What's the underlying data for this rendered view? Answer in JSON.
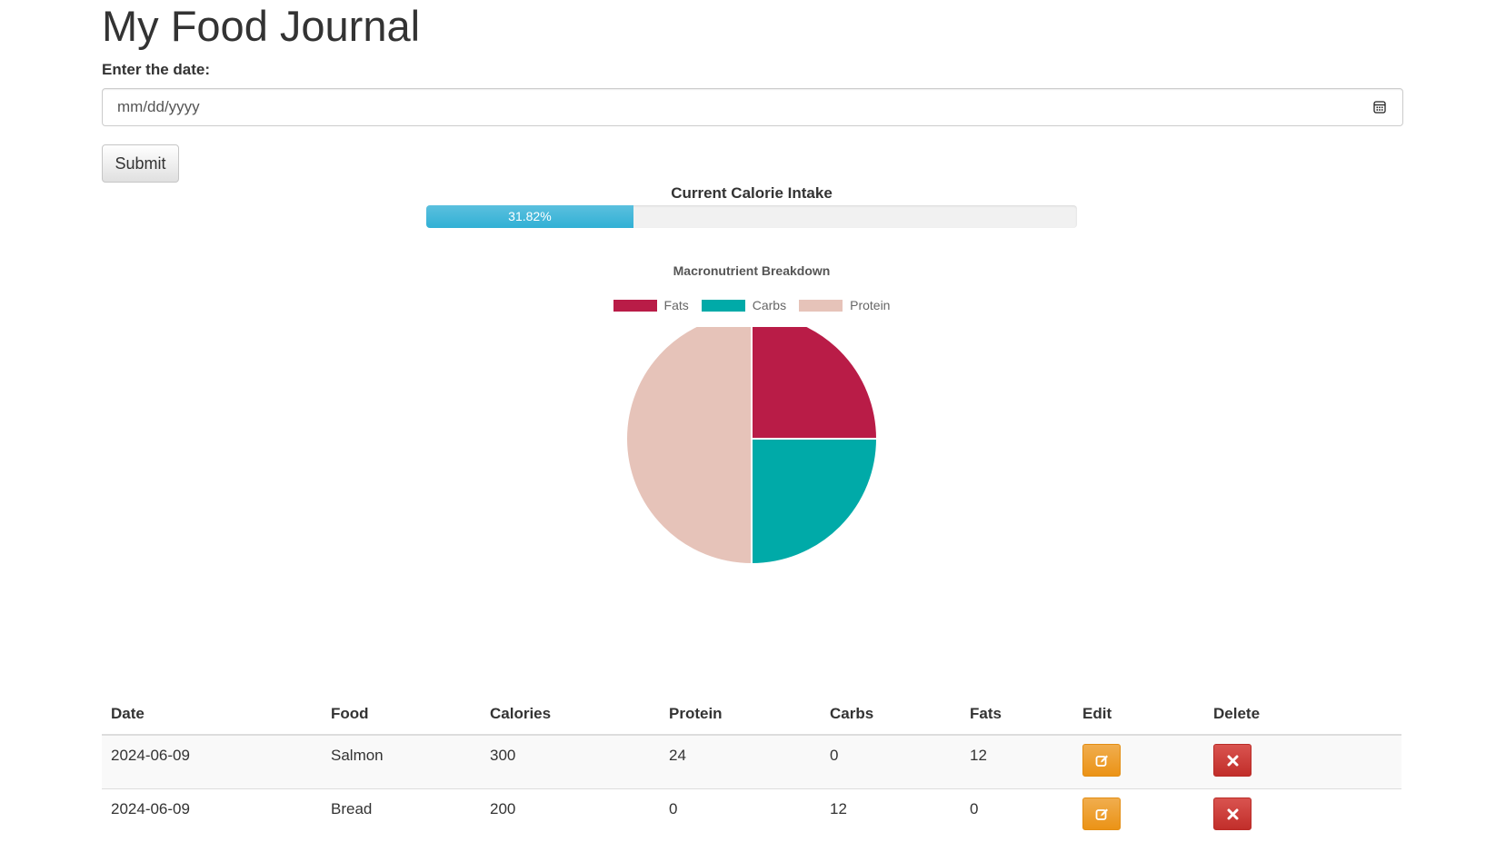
{
  "page": {
    "title": "My Food Journal"
  },
  "date_form": {
    "label": "Enter the date:",
    "placeholder": "mm/dd/yyyy",
    "value": "",
    "calendar_icon": "calendar-icon",
    "submit_label": "Submit"
  },
  "calorie_progress": {
    "title": "Current Calorie Intake",
    "percent": 31.82,
    "label": "31.82%",
    "color": "#5bc0de"
  },
  "chart_data": {
    "type": "pie",
    "title": "Macronutrient Breakdown",
    "categories": [
      "Fats",
      "Carbs",
      "Protein"
    ],
    "values": [
      12,
      12,
      24
    ],
    "colors": [
      "#b91c47",
      "#00aaa8",
      "#e6c3b9"
    ],
    "legend_position": "top"
  },
  "table": {
    "headers": [
      "Date",
      "Food",
      "Calories",
      "Protein",
      "Carbs",
      "Fats",
      "Edit",
      "Delete"
    ],
    "rows": [
      {
        "date": "2024-06-09",
        "food": "Salmon",
        "calories": "300",
        "protein": "24",
        "carbs": "0",
        "fats": "12"
      },
      {
        "date": "2024-06-09",
        "food": "Bread",
        "calories": "200",
        "protein": "0",
        "carbs": "12",
        "fats": "0"
      }
    ],
    "edit_icon": "edit-icon",
    "delete_icon": "close-icon",
    "edit_color": "#f0ad4e",
    "delete_color": "#d9534f"
  }
}
